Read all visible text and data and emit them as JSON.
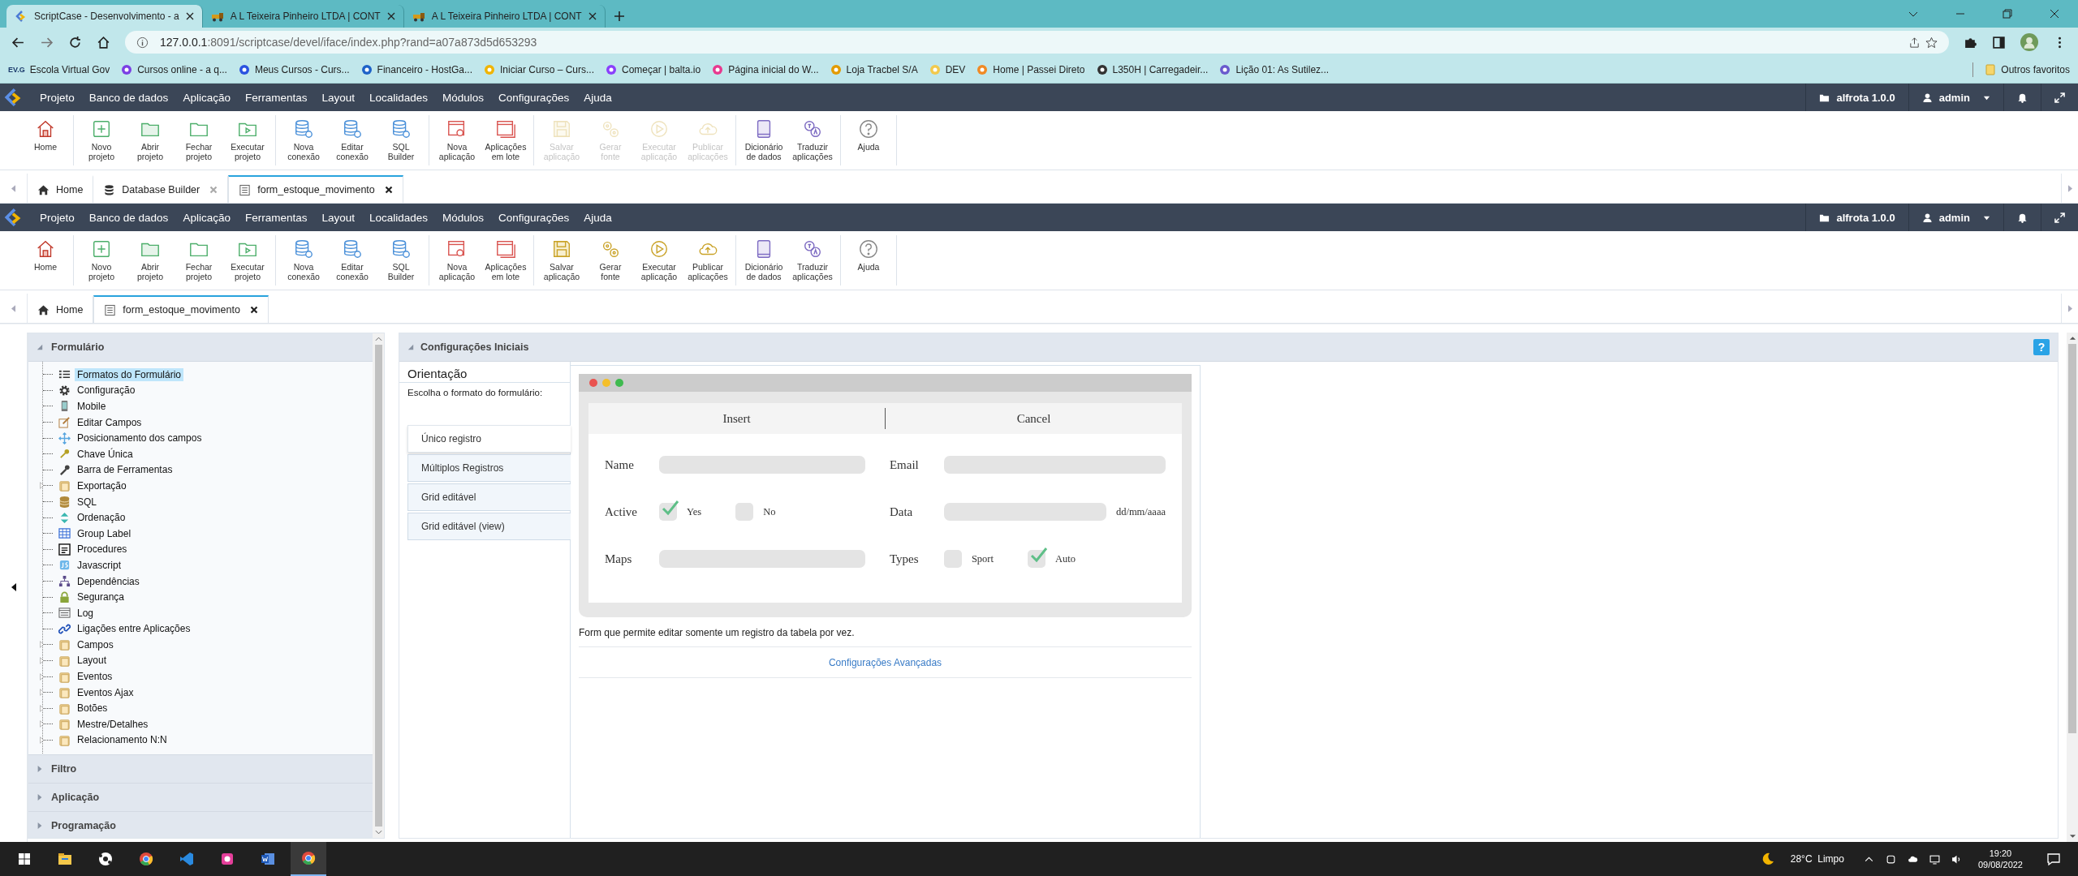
{
  "browser": {
    "tabs": [
      {
        "title": "ScriptCase - Desenvolvimento - a",
        "selected": true
      },
      {
        "title": "A L Teixeira Pinheiro LTDA | CONT",
        "selected": false
      },
      {
        "title": "A L Teixeira Pinheiro LTDA | CONT",
        "selected": false
      }
    ],
    "address": {
      "host": "127.0.0.1",
      "path": ":8091/scriptcase/devel/iface/index.php?rand=a07a873d5d653293"
    },
    "bookmarks": [
      {
        "label": "Escola Virtual Gov",
        "logo": "EV.G"
      },
      {
        "label": "Cursos online - a q..."
      },
      {
        "label": "Meus Cursos - Curs..."
      },
      {
        "label": "Financeiro - HostGa..."
      },
      {
        "label": "Iniciar Curso – Curs..."
      },
      {
        "label": "Começar | balta.io"
      },
      {
        "label": "Página inicial do W..."
      },
      {
        "label": "Loja Tracbel S/A"
      },
      {
        "label": "DEV"
      },
      {
        "label": "Home | Passei Direto"
      },
      {
        "label": "L350H | Carregadeir..."
      },
      {
        "label": "Lição 01: As Sutilez..."
      }
    ],
    "other_bookmarks": "Outros favoritos"
  },
  "app_frames": [
    {
      "menu": [
        "Projeto",
        "Banco de dados",
        "Aplicação",
        "Ferramentas",
        "Layout",
        "Localidades",
        "Módulos",
        "Configurações",
        "Ajuda"
      ],
      "project": "alfrota 1.0.0",
      "user": "admin",
      "toolbar": [
        [
          {
            "kind": "home",
            "lines": [
              "Home"
            ],
            "disabled": false
          }
        ],
        [
          {
            "kind": "new",
            "lines": [
              "Novo",
              "projeto"
            ],
            "disabled": false
          },
          {
            "kind": "open",
            "lines": [
              "Abrir",
              "projeto"
            ],
            "disabled": false
          },
          {
            "kind": "close",
            "lines": [
              "Fechar",
              "projeto"
            ],
            "disabled": false
          },
          {
            "kind": "run",
            "lines": [
              "Executar",
              "projeto"
            ],
            "disabled": false
          }
        ],
        [
          {
            "kind": "dbnew",
            "lines": [
              "Nova",
              "conexão"
            ],
            "disabled": false
          },
          {
            "kind": "dbedit",
            "lines": [
              "Editar",
              "conexão"
            ],
            "disabled": false
          },
          {
            "kind": "sqlbuilder",
            "lines": [
              "SQL",
              "Builder"
            ],
            "disabled": false
          }
        ],
        [
          {
            "kind": "appnew",
            "lines": [
              "Nova",
              "aplicação"
            ],
            "disabled": false
          },
          {
            "kind": "appbatch",
            "lines": [
              "Aplicações",
              "em lote"
            ],
            "disabled": false
          }
        ],
        [
          {
            "kind": "save",
            "lines": [
              "Salvar",
              "aplicação"
            ],
            "disabled": true
          },
          {
            "kind": "generate",
            "lines": [
              "Gerar",
              "fonte"
            ],
            "disabled": true
          },
          {
            "kind": "execute",
            "lines": [
              "Executar",
              "aplicação"
            ],
            "disabled": true
          },
          {
            "kind": "publish",
            "lines": [
              "Publicar",
              "aplicações"
            ],
            "disabled": true
          }
        ],
        [
          {
            "kind": "dictionary",
            "lines": [
              "Dicionário",
              "de dados"
            ],
            "disabled": false
          },
          {
            "kind": "translate",
            "lines": [
              "Traduzir",
              "aplicações"
            ],
            "disabled": false
          }
        ],
        [
          {
            "kind": "help",
            "lines": [
              "Ajuda"
            ],
            "disabled": false
          }
        ]
      ],
      "tabs": [
        {
          "kind": "home",
          "label": "Home",
          "selected": false,
          "closable": false
        },
        {
          "kind": "database",
          "label": "Database Builder",
          "selected": false,
          "closable": true
        },
        {
          "kind": "form",
          "label": "form_estoque_movimento",
          "selected": true,
          "closable": true
        }
      ]
    },
    {
      "menu": [
        "Projeto",
        "Banco de dados",
        "Aplicação",
        "Ferramentas",
        "Layout",
        "Localidades",
        "Módulos",
        "Configurações",
        "Ajuda"
      ],
      "project": "alfrota 1.0.0",
      "user": "admin",
      "toolbar": [
        [
          {
            "kind": "home",
            "lines": [
              "Home"
            ],
            "disabled": false
          }
        ],
        [
          {
            "kind": "new",
            "lines": [
              "Novo",
              "projeto"
            ],
            "disabled": false
          },
          {
            "kind": "open",
            "lines": [
              "Abrir",
              "projeto"
            ],
            "disabled": false
          },
          {
            "kind": "close",
            "lines": [
              "Fechar",
              "projeto"
            ],
            "disabled": false
          },
          {
            "kind": "run",
            "lines": [
              "Executar",
              "projeto"
            ],
            "disabled": false
          }
        ],
        [
          {
            "kind": "dbnew",
            "lines": [
              "Nova",
              "conexão"
            ],
            "disabled": false
          },
          {
            "kind": "dbedit",
            "lines": [
              "Editar",
              "conexão"
            ],
            "disabled": false
          },
          {
            "kind": "sqlbuilder",
            "lines": [
              "SQL",
              "Builder"
            ],
            "disabled": false
          }
        ],
        [
          {
            "kind": "appnew",
            "lines": [
              "Nova",
              "aplicação"
            ],
            "disabled": false
          },
          {
            "kind": "appbatch",
            "lines": [
              "Aplicações",
              "em lote"
            ],
            "disabled": false
          }
        ],
        [
          {
            "kind": "save",
            "lines": [
              "Salvar",
              "aplicação"
            ],
            "disabled": false
          },
          {
            "kind": "generate",
            "lines": [
              "Gerar",
              "fonte"
            ],
            "disabled": false
          },
          {
            "kind": "execute",
            "lines": [
              "Executar",
              "aplicação"
            ],
            "disabled": false
          },
          {
            "kind": "publish",
            "lines": [
              "Publicar",
              "aplicações"
            ],
            "disabled": false
          }
        ],
        [
          {
            "kind": "dictionary",
            "lines": [
              "Dicionário",
              "de dados"
            ],
            "disabled": false
          },
          {
            "kind": "translate",
            "lines": [
              "Traduzir",
              "aplicações"
            ],
            "disabled": false
          }
        ],
        [
          {
            "kind": "help",
            "lines": [
              "Ajuda"
            ],
            "disabled": false
          }
        ]
      ],
      "tabs": [
        {
          "kind": "home",
          "label": "Home",
          "selected": false,
          "closable": false
        },
        {
          "kind": "form",
          "label": "form_estoque_movimento",
          "selected": true,
          "closable": true
        }
      ]
    }
  ],
  "sidebar": {
    "sections": [
      {
        "title": "Formulário",
        "expanded": true,
        "items": [
          {
            "kind": "list",
            "label": "Formatos do Formulário",
            "selected": true,
            "has_children": false
          },
          {
            "kind": "gear",
            "label": "Configuração",
            "selected": false,
            "has_children": false
          },
          {
            "kind": "mobile",
            "label": "Mobile",
            "selected": false,
            "has_children": false
          },
          {
            "kind": "edit",
            "label": "Editar Campos",
            "selected": false,
            "has_children": false
          },
          {
            "kind": "move",
            "label": "Posicionamento dos campos",
            "selected": false,
            "has_children": false
          },
          {
            "kind": "key",
            "label": "Chave Única",
            "selected": false,
            "has_children": false
          },
          {
            "kind": "wrench",
            "label": "Barra de Ferramentas",
            "selected": false,
            "has_children": false
          },
          {
            "kind": "folder",
            "label": "Exportação",
            "selected": false,
            "has_children": true
          },
          {
            "kind": "database",
            "label": "SQL",
            "selected": false,
            "has_children": false
          },
          {
            "kind": "sort",
            "label": "Ordenação",
            "selected": false,
            "has_children": false
          },
          {
            "kind": "table",
            "label": "Group Label",
            "selected": false,
            "has_children": false
          },
          {
            "kind": "sql",
            "label": "Procedures",
            "selected": false,
            "has_children": false
          },
          {
            "kind": "script",
            "label": "Javascript",
            "selected": false,
            "has_children": false
          },
          {
            "kind": "hierarchy",
            "label": "Dependências",
            "selected": false,
            "has_children": false
          },
          {
            "kind": "lock",
            "label": "Segurança",
            "selected": false,
            "has_children": false
          },
          {
            "kind": "log",
            "label": "Log",
            "selected": false,
            "has_children": false
          },
          {
            "kind": "link",
            "label": "Ligações entre Aplicações",
            "selected": false,
            "has_children": false
          },
          {
            "kind": "folder",
            "label": "Campos",
            "selected": false,
            "has_children": true
          },
          {
            "kind": "folder",
            "label": "Layout",
            "selected": false,
            "has_children": true
          },
          {
            "kind": "folder",
            "label": "Eventos",
            "selected": false,
            "has_children": true
          },
          {
            "kind": "folder",
            "label": "Eventos Ajax",
            "selected": false,
            "has_children": true
          },
          {
            "kind": "folder",
            "label": "Botões",
            "selected": false,
            "has_children": true
          },
          {
            "kind": "folder",
            "label": "Mestre/Detalhes",
            "selected": false,
            "has_children": true
          },
          {
            "kind": "folder",
            "label": "Relacionamento N:N",
            "selected": false,
            "has_children": true
          }
        ]
      },
      {
        "title": "Filtro",
        "expanded": false
      },
      {
        "title": "Aplicação",
        "expanded": false
      },
      {
        "title": "Programação",
        "expanded": false
      }
    ]
  },
  "panel": {
    "title": "Configurações Iniciais",
    "help": "?",
    "heading": "Orientação",
    "prompt": "Escolha o formato do formulário:",
    "formats": [
      {
        "label": "Único registro",
        "selected": true
      },
      {
        "label": "Múltiplos Registros",
        "selected": false
      },
      {
        "label": "Grid editável",
        "selected": false
      },
      {
        "label": "Grid editável (view)",
        "selected": false
      }
    ],
    "preview": {
      "buttons": [
        "Insert",
        "Cancel"
      ],
      "left": [
        {
          "kind": "field",
          "label": "Name"
        },
        {
          "kind": "checks",
          "label": "Active",
          "options": [
            {
              "label": "Yes",
              "checked": true
            },
            {
              "label": "No",
              "checked": false
            }
          ]
        },
        {
          "kind": "field",
          "label": "Maps"
        }
      ],
      "right": [
        {
          "kind": "field",
          "label": "Email"
        },
        {
          "kind": "date",
          "label": "Data",
          "hint": "dd/mm/aaaa"
        },
        {
          "kind": "checks",
          "label": "Types",
          "options": [
            {
              "label": "Sport",
              "checked": false
            },
            {
              "label": "Auto",
              "checked": true
            }
          ]
        }
      ]
    },
    "description": "Form que permite editar somente um registro da tabela por vez.",
    "advanced_link": "Configurações Avançadas"
  },
  "taskbar": {
    "apps": [
      {
        "kind": "explorer",
        "selected": false
      },
      {
        "kind": "ball",
        "selected": false
      },
      {
        "kind": "chrome",
        "selected": false
      },
      {
        "kind": "vscode",
        "selected": false
      },
      {
        "kind": "pink",
        "selected": false
      },
      {
        "kind": "word",
        "selected": false
      },
      {
        "kind": "chrome",
        "selected": true
      }
    ],
    "weather": "28°C  Limpo",
    "time": "19:20",
    "date": "09/08/2022"
  }
}
